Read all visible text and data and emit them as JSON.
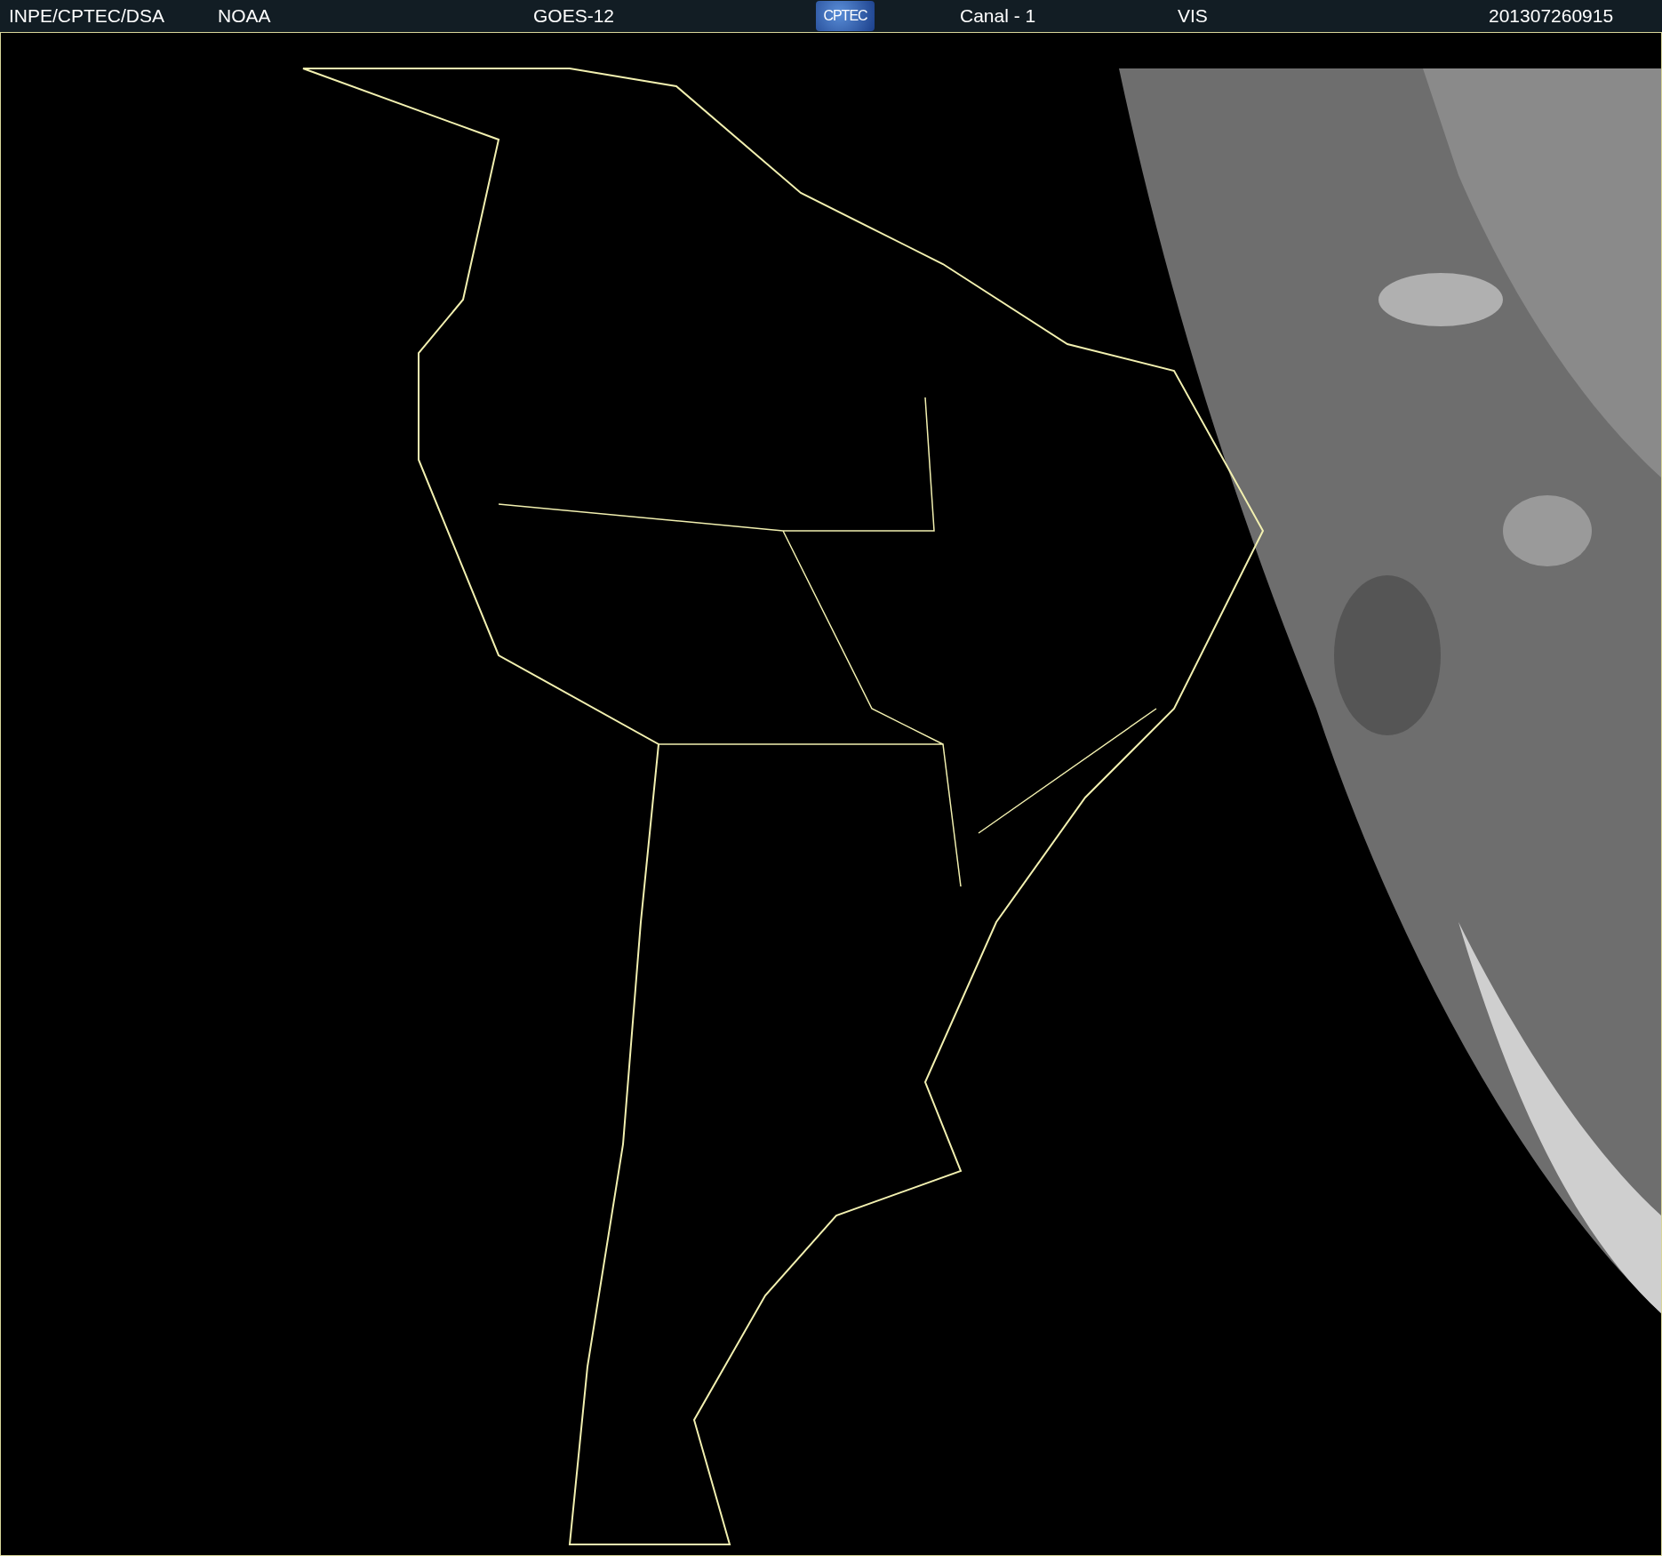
{
  "header": {
    "source": "INPE/CPTEC/DSA",
    "agency": "NOAA",
    "satellite": "GOES-12",
    "logo": "CPTEC",
    "channel": "Canal - 1",
    "band": "VIS",
    "timestamp": "201307260915"
  }
}
